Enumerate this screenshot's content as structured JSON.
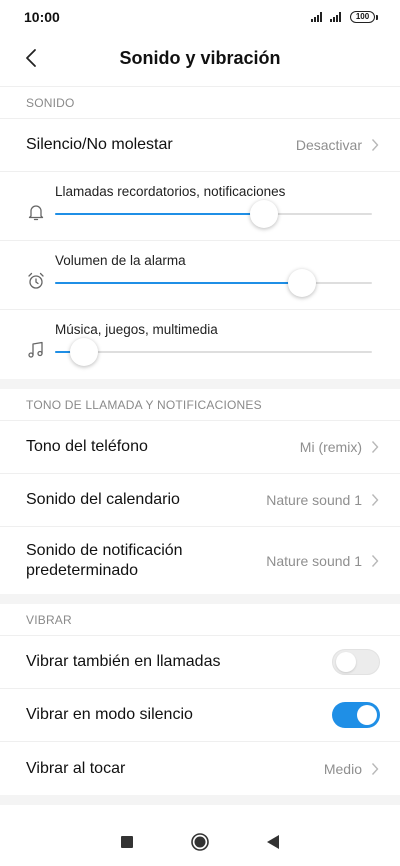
{
  "status": {
    "time": "10:00",
    "battery": "100",
    "icons": [
      "signal-icon",
      "signal-icon",
      "battery-icon"
    ]
  },
  "header": {
    "title": "Sonido y vibración",
    "back_icon": "back-arrow-icon"
  },
  "sound_section": {
    "header": "SONIDO",
    "dnd": {
      "label": "Silencio/No molestar",
      "value": "Desactivar"
    },
    "sliders": [
      {
        "label": "Llamadas recordatorios, notificaciones",
        "icon": "bell-icon",
        "level": 0.66
      },
      {
        "label": "Volumen de la alarma",
        "icon": "alarm-clock-icon",
        "level": 0.78
      },
      {
        "label": "Música, juegos, multimedia",
        "icon": "music-note-icon",
        "level": 0.09
      }
    ]
  },
  "ringtone_section": {
    "header": "TONO DE LLAMADA Y NOTIFICACIONES",
    "items": [
      {
        "label": "Tono del teléfono",
        "value": "Mi (remix)"
      },
      {
        "label": "Sonido del calendario",
        "value": "Nature sound 1"
      },
      {
        "label_line1": "Sonido de notificación",
        "label_line2": "predeterminado",
        "value": "Nature sound 1"
      }
    ]
  },
  "vibrate_section": {
    "header": "VIBRAR",
    "calls": {
      "label": "Vibrar también en llamadas",
      "on": false
    },
    "silent": {
      "label": "Vibrar en modo silencio",
      "on": true
    },
    "touch": {
      "label": "Vibrar al tocar",
      "value": "Medio"
    }
  },
  "nav": {
    "icons": [
      "recents-square-icon",
      "home-circle-icon",
      "back-triangle-icon"
    ]
  },
  "colors": {
    "accent": "#1f8fe6",
    "secondary_text": "#8f8f8f",
    "section_band": "#f4f4f4"
  }
}
